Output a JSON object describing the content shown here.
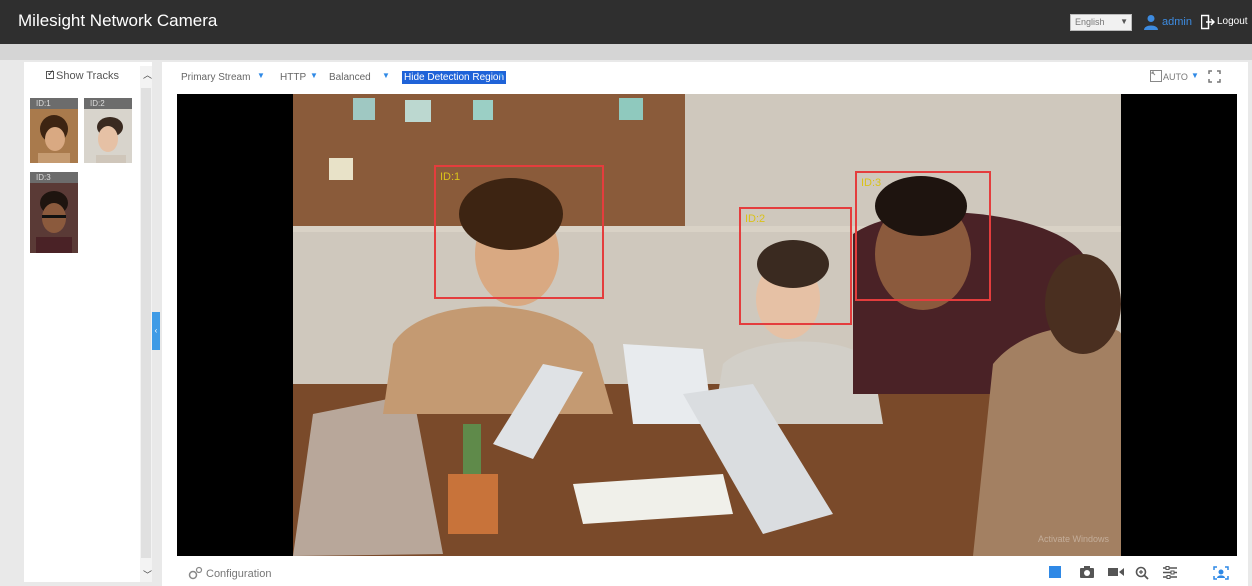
{
  "header": {
    "title": "Milesight Network Camera",
    "language": "English",
    "user": "admin",
    "logout": "Logout"
  },
  "tracks": {
    "show_tracks_label": "Show Tracks",
    "show_tracks_checked": true,
    "items": [
      {
        "id": "ID:1"
      },
      {
        "id": "ID:2"
      },
      {
        "id": "ID:3"
      }
    ]
  },
  "toolbar": {
    "stream": "Primary Stream",
    "protocol": "HTTP",
    "mode": "Balanced",
    "region": "Hide Detection Region",
    "zoom": "AUTO"
  },
  "video": {
    "detections": [
      {
        "label": "ID:1"
      },
      {
        "label": "ID:2"
      },
      {
        "label": "ID:3"
      }
    ],
    "watermark": "Activate Windows"
  },
  "footer": {
    "configuration": "Configuration"
  },
  "colors": {
    "accent": "#2f89e6",
    "detection_box": "#e43d3d",
    "detection_label": "#d9c21a",
    "header_bg": "#2f2f2f"
  }
}
